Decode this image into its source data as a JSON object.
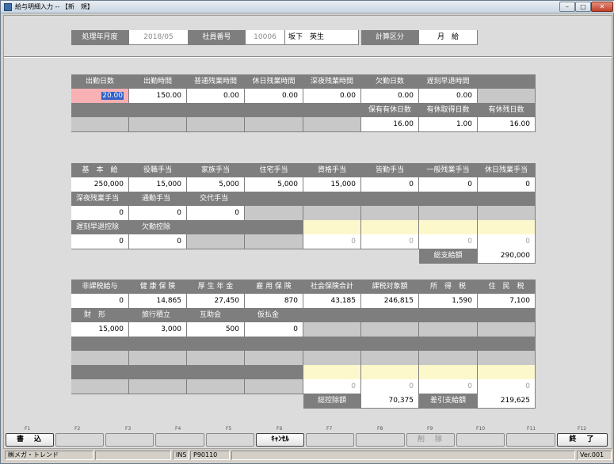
{
  "window": {
    "title": "給与明細入力 -- 【新　規】",
    "min_label": "–",
    "max_label": "□",
    "close_label": "✕"
  },
  "header": {
    "period_label": "処理年月度",
    "period_value": "2018/05",
    "emp_label": "社員番号",
    "emp_no": "10006",
    "emp_name": "坂下　英生",
    "calc_label": "計算区分",
    "calc_value": "月　給"
  },
  "attendance": {
    "headers": [
      "出勤日数",
      "出勤時間",
      "普通残業時間",
      "休日残業時間",
      "深夜残業時間",
      "欠勤日数",
      "遅刻早退時間"
    ],
    "values": [
      "20.00",
      "150.00",
      "0.00",
      "0.00",
      "0.00",
      "0.00",
      "0.00"
    ],
    "leave_headers": [
      "保有有休日数",
      "有休取得日数",
      "有休残日数"
    ],
    "leave_values": [
      "16.00",
      "1.00",
      "16.00"
    ]
  },
  "payments": {
    "headers1": [
      "基　本　給",
      "役職手当",
      "家族手当",
      "住宅手当",
      "資格手当",
      "皆勤手当",
      "一般残業手当",
      "休日残業手当"
    ],
    "values1": [
      "250,000",
      "15,000",
      "5,000",
      "5,000",
      "15,000",
      "0",
      "0",
      "0"
    ],
    "headers2": [
      "深夜残業手当",
      "通勤手当",
      "交代手当"
    ],
    "values2": [
      "0",
      "0",
      "0"
    ],
    "headers3": [
      "遅刻早退控除",
      "欠勤控除"
    ],
    "values3": [
      "0",
      "0"
    ],
    "blank_values": [
      "0",
      "0",
      "0",
      "0"
    ],
    "total_label": "総支給額",
    "total_value": "290,000"
  },
  "deductions": {
    "headers1": [
      "非課税給与",
      "健 康 保 険",
      "厚 生 年 金",
      "雇 用 保 険",
      "社会保険合計",
      "課税対象額",
      "所　得　税",
      "住　民　税"
    ],
    "values1": [
      "0",
      "14,865",
      "27,450",
      "870",
      "43,185",
      "246,815",
      "1,590",
      "7,100"
    ],
    "headers2": [
      "財　形",
      "旅行積立",
      "互助会",
      "仮払金"
    ],
    "values2": [
      "15,000",
      "3,000",
      "500",
      "0"
    ],
    "blank_values": [
      "0",
      "0",
      "0",
      "0"
    ],
    "total_ded_label": "総控除額",
    "total_ded_value": "70,375",
    "net_label": "差引支給額",
    "net_value": "219,625"
  },
  "fkeys": {
    "labels": [
      "F1",
      "F2",
      "F3",
      "F4",
      "F5",
      "F6",
      "F7",
      "F8",
      "F9",
      "F10",
      "F11",
      "F12"
    ],
    "f1": "書　込",
    "f6": "ｷｬﾝｾﾙ",
    "f9": "削　除",
    "f12": "終　了"
  },
  "status": {
    "company": "㈱メガ・トレンド",
    "mode": "INS",
    "code": "P90110",
    "version": "Ver.001"
  }
}
